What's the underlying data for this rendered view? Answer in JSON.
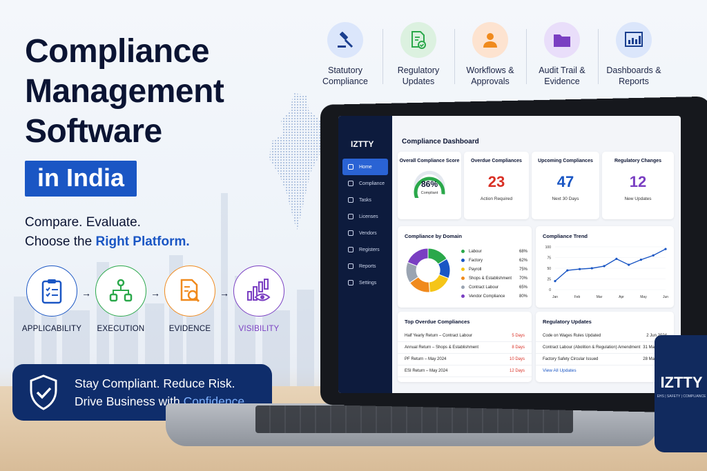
{
  "headline": {
    "line1": "Compliance",
    "line2": "Management",
    "line3": "Software",
    "badge": "in India"
  },
  "tagline": {
    "line1": "Compare. Evaluate.",
    "line2_prefix": "Choose the ",
    "line2_highlight": "Right Platform."
  },
  "process": [
    {
      "label": "APPLICABILITY",
      "icon": "clipboard-checklist-icon",
      "color": "#1a56c4"
    },
    {
      "label": "EXECUTION",
      "icon": "workflow-gear-icon",
      "color": "#2aa84a"
    },
    {
      "label": "EVIDENCE",
      "icon": "document-magnifier-icon",
      "color": "#f08a1d"
    },
    {
      "label": "VISIBILITY",
      "icon": "chart-eye-icon",
      "color": "#7a3fc2"
    }
  ],
  "banner": {
    "line1": "Stay Compliant. Reduce Risk.",
    "line2_prefix": "Drive Business with ",
    "line2_highlight": "Confidence."
  },
  "features": [
    {
      "l1": "Statutory",
      "l2": "Compliance",
      "icon": "gavel-icon",
      "bg": "#dbe6fb"
    },
    {
      "l1": "Regulatory",
      "l2": "Updates",
      "icon": "document-check-icon",
      "bg": "#dcf1e0"
    },
    {
      "l1": "Workflows &",
      "l2": "Approvals",
      "icon": "people-icon",
      "bg": "#fde3d0"
    },
    {
      "l1": "Audit Trail &",
      "l2": "Evidence",
      "icon": "folder-icon",
      "bg": "#e9defa"
    },
    {
      "l1": "Dashboards &",
      "l2": "Reports",
      "icon": "bar-chart-icon",
      "bg": "#dbe6fb"
    }
  ],
  "app": {
    "brand": "IZTTY",
    "nav": [
      "Home",
      "Compliance",
      "Tasks",
      "Licenses",
      "Vendors",
      "Registers",
      "Reports",
      "Settings"
    ],
    "title": "Compliance Dashboard",
    "kpis": {
      "score_title": "Overall Compliance Score",
      "score_value": "86%",
      "score_sub": "Compliant",
      "overdue_title": "Overdue Compliances",
      "overdue_value": "23",
      "overdue_sub": "Action Required",
      "upcoming_title": "Upcoming Compliances",
      "upcoming_value": "47",
      "upcoming_sub": "Next 30 Days",
      "reg_title": "Regulatory Changes",
      "reg_value": "12",
      "reg_sub": "New Updates"
    },
    "domain_title": "Compliance by Domain",
    "domains": [
      {
        "name": "Labour",
        "pct": "68%",
        "color": "#2aa84a"
      },
      {
        "name": "Factory",
        "pct": "62%",
        "color": "#1a56c4"
      },
      {
        "name": "Payroll",
        "pct": "75%",
        "color": "#f5c518"
      },
      {
        "name": "Shops & Establishment",
        "pct": "70%",
        "color": "#f08a1d"
      },
      {
        "name": "Contract Labour",
        "pct": "65%",
        "color": "#9aa4b2"
      },
      {
        "name": "Vendor Compliance",
        "pct": "80%",
        "color": "#7a3fc2"
      }
    ],
    "trend_title": "Compliance Trend",
    "overdue_list_title": "Top Overdue Compliances",
    "overdue_list": [
      {
        "name": "Half Yearly Return – Contract Labour",
        "days": "5 Days"
      },
      {
        "name": "Annual Return – Shops & Establishment",
        "days": "8 Days"
      },
      {
        "name": "PF Return – May 2024",
        "days": "10 Days"
      },
      {
        "name": "ESI Return – May 2024",
        "days": "12 Days"
      }
    ],
    "updates_title": "Regulatory Updates",
    "updates": [
      {
        "name": "Code on Wages Rules Updated",
        "date": "2 Jun 2024"
      },
      {
        "name": "Contract Labour (Abolition & Regulation) Amendment",
        "date": "31 May 2024"
      },
      {
        "name": "Factory Safety Circular Issued",
        "date": "28 May 2024"
      }
    ],
    "view_all": "View All Updates"
  },
  "chart_data": {
    "type": "line",
    "title": "Compliance Trend",
    "categories": [
      "Jan",
      "Feb",
      "Mar",
      "Apr",
      "May",
      "Jun"
    ],
    "yticks": [
      "100",
      "75",
      "50",
      "25",
      "0"
    ],
    "ylim": [
      0,
      100
    ],
    "values": [
      20,
      45,
      48,
      50,
      55,
      72,
      58,
      70,
      80,
      95
    ]
  },
  "mug": {
    "brand": "IZTTY",
    "sub": "EHS | SAFETY | COMPLIANCE"
  }
}
